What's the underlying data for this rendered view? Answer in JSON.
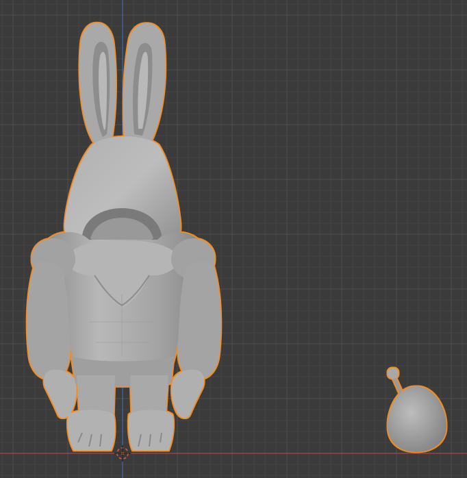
{
  "viewport": {
    "view": "front-orthographic",
    "colors": {
      "background": "#3b3b3b",
      "grid_minor": "#444444",
      "grid_major": "#4f4f4f",
      "x_axis": "#a8464f",
      "z_axis": "#3f6ca9",
      "selection_outline": "#f28c1f",
      "mesh_base": "#a6a6a6",
      "mesh_light": "#c2c2c2",
      "mesh_dark": "#7e7e7e"
    }
  },
  "scene": {
    "objects": [
      {
        "name": "rabbit-costume-figure",
        "selected": true,
        "shading": "solid"
      },
      {
        "name": "egg-with-antenna",
        "selected": true,
        "shading": "solid"
      }
    ],
    "origin_marker": "3d-cursor-icon"
  }
}
